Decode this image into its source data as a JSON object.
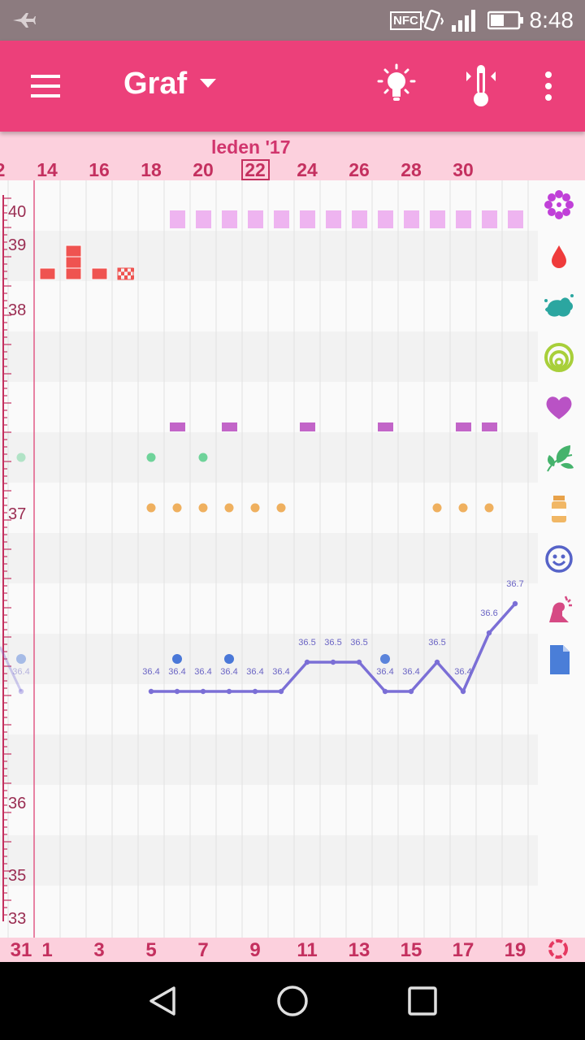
{
  "status_bar": {
    "time": "8:48",
    "nfc_label": "NFC"
  },
  "app_bar": {
    "title": "Graf"
  },
  "date_header": {
    "month": "leden '17",
    "top_days": [
      "2",
      "14",
      "16",
      "18",
      "20",
      "22",
      "24",
      "26",
      "28",
      "30"
    ],
    "today": "22"
  },
  "y_axis": {
    "labels": [
      "40",
      "39",
      "38",
      "37",
      "36",
      "35",
      "33"
    ]
  },
  "bottom_days": [
    "31",
    "1",
    "3",
    "5",
    "7",
    "9",
    "11",
    "13",
    "15",
    "17",
    "19"
  ],
  "chart_data": {
    "type": "line",
    "title": "",
    "xlabel": "",
    "ylabel": "",
    "x": [
      "31",
      "5",
      "6",
      "7",
      "8",
      "9",
      "10",
      "11",
      "12",
      "13",
      "14",
      "15",
      "16",
      "17",
      "18",
      "19"
    ],
    "series": [
      {
        "name": "",
        "values": [
          36.4,
          36.4,
          36.4,
          36.4,
          36.4,
          36.4,
          36.4,
          36.5,
          36.5,
          36.5,
          36.4,
          36.4,
          36.5,
          36.4,
          36.6,
          36.7
        ]
      }
    ],
    "point_labels": [
      "36.4",
      "36.4",
      "36.4",
      "36.4",
      "36.4",
      "36.4",
      "36.4",
      "36.5",
      "36.5",
      "36.5",
      "36.4",
      "36.4",
      "36.5",
      "36.4",
      "36.6",
      "36.7"
    ],
    "colors": {
      "line": "#7b6fd6",
      "period": "#ef5350",
      "fertile": "#eeb4f0",
      "intercourse": "#c265c8",
      "herb": "#6fd39a",
      "supplement": "#efb05f",
      "mood": "#4a78d8"
    }
  },
  "legend": [
    "flower-icon",
    "drop-icon",
    "splash-icon",
    "cervix-icon",
    "heart-icon",
    "leaf-icon",
    "pill-bottle-icon",
    "smiley-icon",
    "symptom-icon",
    "note-icon"
  ]
}
